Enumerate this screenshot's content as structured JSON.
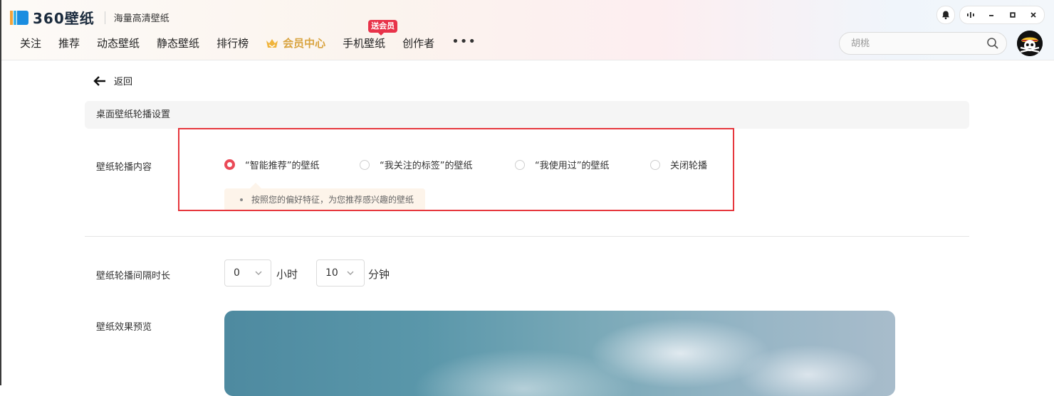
{
  "app": {
    "logo_text": "360壁纸",
    "slogan": "海量高清壁纸"
  },
  "nav": {
    "items": [
      "关注",
      "推荐",
      "动态壁纸",
      "静态壁纸",
      "排行榜"
    ],
    "vip_label": "会员中心",
    "phone_label": "手机壁纸",
    "phone_badge": "送会员",
    "creator_label": "创作者",
    "more_label": "•••"
  },
  "search": {
    "placeholder": "胡桃"
  },
  "page": {
    "back_label": "返回",
    "section_title": "桌面壁纸轮播设置",
    "carousel_content_label": "壁纸轮播内容",
    "options": [
      {
        "label": "“智能推荐”的壁纸",
        "selected": true
      },
      {
        "label": "“我关注的标签”的壁纸",
        "selected": false
      },
      {
        "label": "“我使用过”的壁纸",
        "selected": false
      },
      {
        "label": "关闭轮播",
        "selected": false
      }
    ],
    "tip": "按照您的偏好特征，为您推荐感兴趣的壁纸",
    "interval_label": "壁纸轮播间隔时长",
    "hours_value": "0",
    "hours_unit": "小时",
    "minutes_value": "10",
    "minutes_unit": "分钟",
    "preview_label": "壁纸效果预览"
  },
  "colors": {
    "accent_red": "#ea4a57",
    "vip_gold": "#d9a441",
    "highlight_box": "#e6373d"
  }
}
